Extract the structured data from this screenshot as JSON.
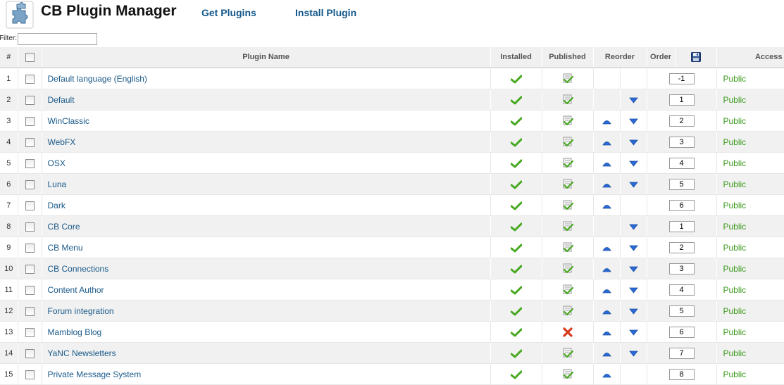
{
  "header": {
    "title": "CB Plugin Manager",
    "get_plugins": "Get Plugins",
    "install_plugin": "Install Plugin",
    "logo_icon": "puzzle-piece-icon"
  },
  "filter": {
    "label": "Filter:",
    "value": ""
  },
  "columns": {
    "num": "#",
    "name": "Plugin Name",
    "installed": "Installed",
    "published": "Published",
    "reorder": "Reorder",
    "order": "Order",
    "save_order_icon": "save-disk-icon",
    "access": "Access"
  },
  "colors": {
    "link": "#1a5a8a",
    "access": "#3a9a1a",
    "check": "#45a81e",
    "arrow": "#2a6ad8",
    "unpublished": "#d63a1a"
  },
  "rows": [
    {
      "num": "1",
      "name": "Default language (English)",
      "installed": true,
      "published": true,
      "up": false,
      "down": false,
      "order": "-1",
      "access": "Public"
    },
    {
      "num": "2",
      "name": "Default",
      "installed": true,
      "published": true,
      "up": false,
      "down": true,
      "order": "1",
      "access": "Public"
    },
    {
      "num": "3",
      "name": "WinClassic",
      "installed": true,
      "published": true,
      "up": true,
      "down": true,
      "order": "2",
      "access": "Public"
    },
    {
      "num": "4",
      "name": "WebFX",
      "installed": true,
      "published": true,
      "up": true,
      "down": true,
      "order": "3",
      "access": "Public"
    },
    {
      "num": "5",
      "name": "OSX",
      "installed": true,
      "published": true,
      "up": true,
      "down": true,
      "order": "4",
      "access": "Public"
    },
    {
      "num": "6",
      "name": "Luna",
      "installed": true,
      "published": true,
      "up": true,
      "down": true,
      "order": "5",
      "access": "Public"
    },
    {
      "num": "7",
      "name": "Dark",
      "installed": true,
      "published": true,
      "up": true,
      "down": false,
      "order": "6",
      "access": "Public"
    },
    {
      "num": "8",
      "name": "CB Core",
      "installed": true,
      "published": true,
      "up": false,
      "down": true,
      "order": "1",
      "access": "Public"
    },
    {
      "num": "9",
      "name": "CB Menu",
      "installed": true,
      "published": true,
      "up": true,
      "down": true,
      "order": "2",
      "access": "Public"
    },
    {
      "num": "10",
      "name": "CB Connections",
      "installed": true,
      "published": true,
      "up": true,
      "down": true,
      "order": "3",
      "access": "Public"
    },
    {
      "num": "11",
      "name": "Content Author",
      "installed": true,
      "published": true,
      "up": true,
      "down": true,
      "order": "4",
      "access": "Public"
    },
    {
      "num": "12",
      "name": "Forum integration",
      "installed": true,
      "published": true,
      "up": true,
      "down": true,
      "order": "5",
      "access": "Public"
    },
    {
      "num": "13",
      "name": "Mamblog Blog",
      "installed": true,
      "published": false,
      "up": true,
      "down": true,
      "order": "6",
      "access": "Public"
    },
    {
      "num": "14",
      "name": "YaNC Newsletters",
      "installed": true,
      "published": true,
      "up": true,
      "down": true,
      "order": "7",
      "access": "Public"
    },
    {
      "num": "15",
      "name": "Private Message System",
      "installed": true,
      "published": true,
      "up": true,
      "down": false,
      "order": "8",
      "access": "Public"
    }
  ]
}
